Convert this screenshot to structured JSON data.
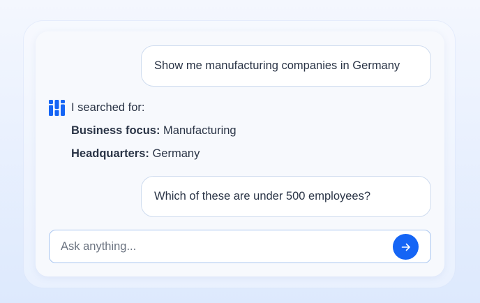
{
  "messages": {
    "user_1": "Show me manufacturing companies in Germany",
    "assistant_intro": "I searched for:",
    "criteria": [
      {
        "key": "Business focus:",
        "value": "Manufacturing"
      },
      {
        "key": "Headquarters:",
        "value": "Germany"
      }
    ],
    "user_2": "Which of these are under 500 employees?"
  },
  "composer": {
    "placeholder": "Ask anything...",
    "send_icon": "arrow-right-icon"
  },
  "colors": {
    "accent": "#1565f5",
    "text": "#2a3446",
    "bubble_border": "#cfdcef"
  }
}
